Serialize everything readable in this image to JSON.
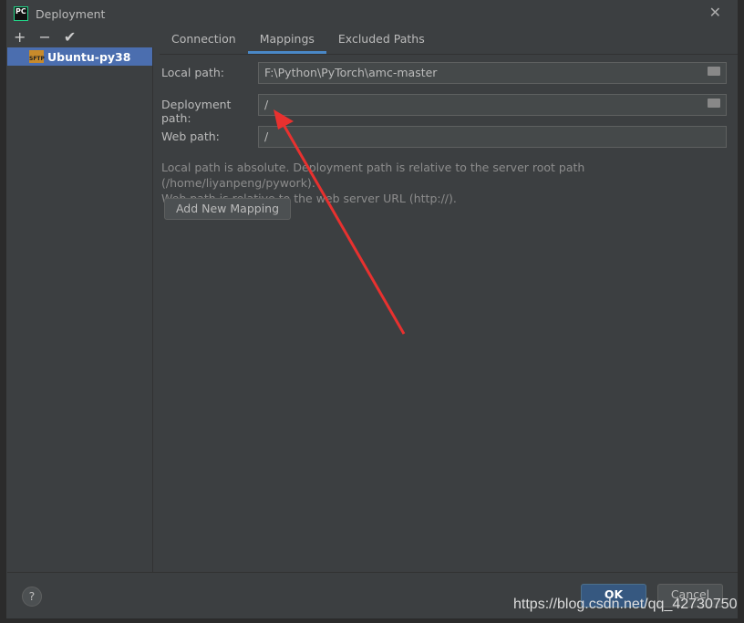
{
  "window": {
    "title": "Deployment",
    "close_icon": "close-icon"
  },
  "toolbar": {
    "add": "+",
    "remove": "−",
    "apply": "✔"
  },
  "servers": [
    {
      "name": "Ubuntu-py38",
      "type": "SFTP"
    }
  ],
  "tabs": [
    {
      "label": "Connection"
    },
    {
      "label": "Mappings",
      "active": true
    },
    {
      "label": "Excluded Paths"
    }
  ],
  "mapping": {
    "local_label": "Local path:",
    "local_value": "F:\\Python\\PyTorch\\amc-master",
    "deploy_label": "Deployment path:",
    "deploy_value": "/",
    "web_label": "Web path:",
    "web_value": "/",
    "hint1": "Local path is absolute. Deployment path is relative to the server root path (/home/liyanpeng/pywork).",
    "hint2": "Web path is relative to the web server URL (http://).",
    "add_mapping": "Add New Mapping"
  },
  "buttons": {
    "help": "?",
    "ok": "OK",
    "cancel": "Cancel"
  },
  "watermark": "https://blog.csdn.net/qq_42730750",
  "colors": {
    "accent": "#4b6eaf",
    "annotation_arrow": "#e8312f"
  }
}
